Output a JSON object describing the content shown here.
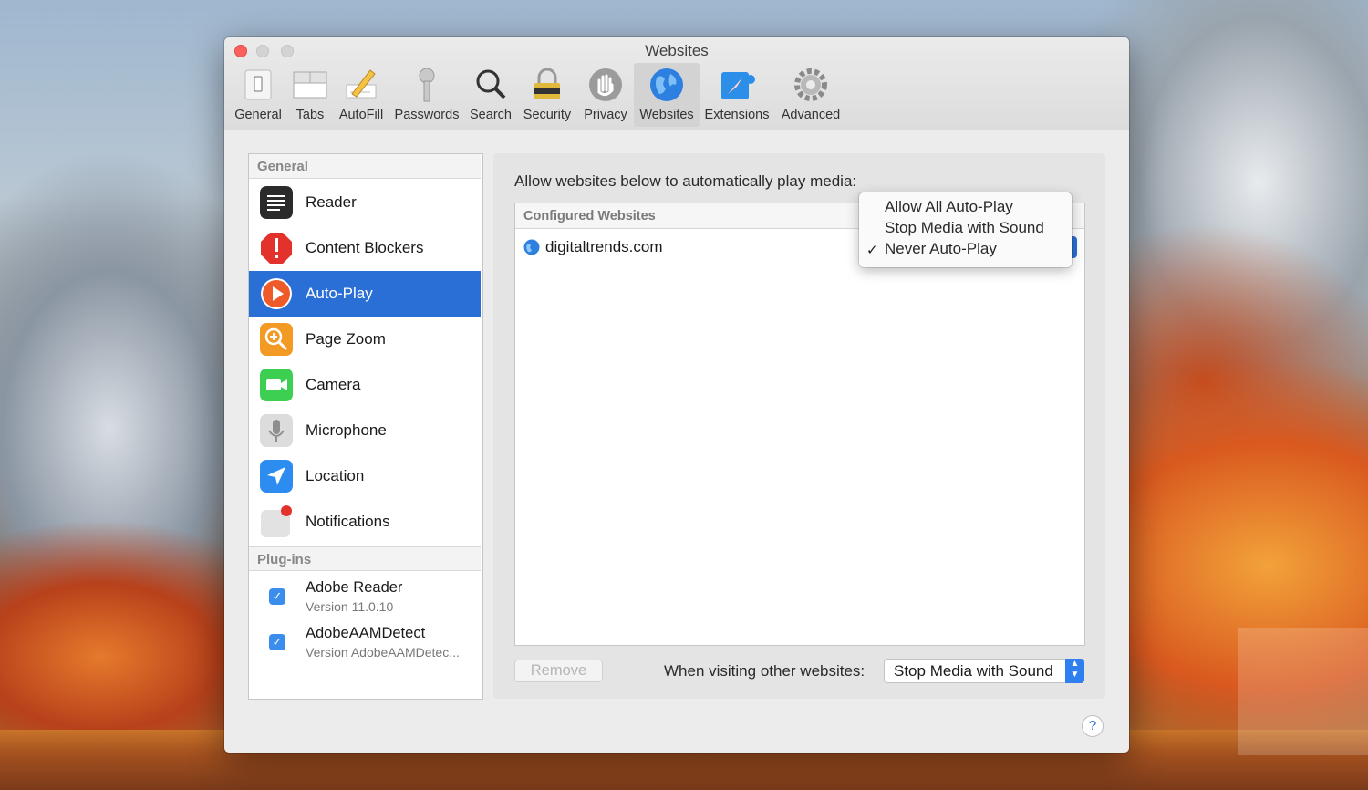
{
  "window": {
    "title": "Websites"
  },
  "toolbar": {
    "items": [
      {
        "label": "General",
        "icon": "general-switch-icon"
      },
      {
        "label": "Tabs",
        "icon": "tabs-icon"
      },
      {
        "label": "AutoFill",
        "icon": "pencil-form-icon"
      },
      {
        "label": "Passwords",
        "icon": "key-icon"
      },
      {
        "label": "Search",
        "icon": "magnifier-icon"
      },
      {
        "label": "Security",
        "icon": "padlock-icon"
      },
      {
        "label": "Privacy",
        "icon": "hand-icon"
      },
      {
        "label": "Websites",
        "icon": "globe-icon",
        "active": true
      },
      {
        "label": "Extensions",
        "icon": "puzzle-compass-icon"
      },
      {
        "label": "Advanced",
        "icon": "gear-icon"
      }
    ]
  },
  "sidebar": {
    "general_header": "General",
    "items": [
      {
        "label": "Reader",
        "icon": "reader-icon"
      },
      {
        "label": "Content Blockers",
        "icon": "stop-sign-icon"
      },
      {
        "label": "Auto-Play",
        "icon": "play-icon",
        "selected": true
      },
      {
        "label": "Page Zoom",
        "icon": "zoom-icon"
      },
      {
        "label": "Camera",
        "icon": "camera-icon"
      },
      {
        "label": "Microphone",
        "icon": "microphone-icon"
      },
      {
        "label": "Location",
        "icon": "location-arrow-icon"
      },
      {
        "label": "Notifications",
        "icon": "notification-badge-icon"
      }
    ],
    "plugins_header": "Plug-ins",
    "plugins": [
      {
        "name": "Adobe Reader",
        "version": "Version 11.0.10",
        "checked": true
      },
      {
        "name": "AdobeAAMDetect",
        "version": "Version AdobeAAMDetec...",
        "checked": true
      }
    ]
  },
  "main": {
    "caption": "Allow websites below to automatically play media:",
    "table_header": "Configured Websites",
    "rows": [
      {
        "site": "digitaltrends.com"
      }
    ],
    "remove_label": "Remove",
    "visiting_label": "When visiting other websites:",
    "visiting_value": "Stop Media with Sound"
  },
  "popup_menu": {
    "options": [
      "Allow All Auto-Play",
      "Stop Media with Sound",
      "Never Auto-Play"
    ],
    "checked_index": 2,
    "check_glyph": "✓"
  },
  "help_label": "?",
  "colors": {
    "selection": "#2a6fd6",
    "close_button": "#fc605c",
    "popup_arrow": "#2f7ff0"
  }
}
